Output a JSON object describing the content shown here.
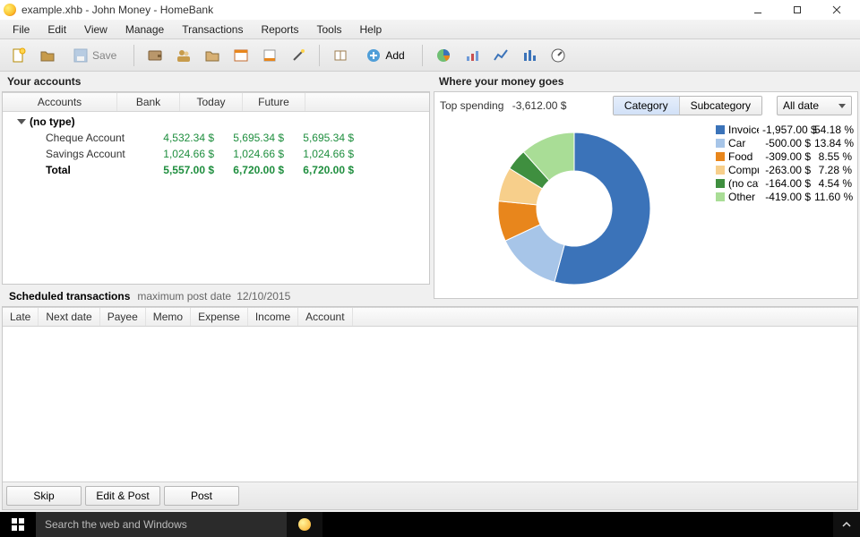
{
  "title": "example.xhb - John Money - HomeBank",
  "window_controls": {
    "minimize": "minimize",
    "maximize": "maximize",
    "close": "close"
  },
  "menu": [
    "File",
    "Edit",
    "View",
    "Manage",
    "Transactions",
    "Reports",
    "Tools",
    "Help"
  ],
  "toolbar": {
    "save_label": "Save",
    "add_label": "Add"
  },
  "accounts_panel": {
    "title": "Your accounts",
    "columns": [
      "Accounts",
      "Bank",
      "Today",
      "Future"
    ],
    "group_label": "(no type)",
    "rows": [
      {
        "name": "Cheque Account",
        "bank": "4,532.34 $",
        "today": "5,695.34 $",
        "future": "5,695.34 $"
      },
      {
        "name": "Savings Account",
        "bank": "1,024.66 $",
        "today": "1,024.66 $",
        "future": "1,024.66 $"
      }
    ],
    "total_label": "Total",
    "total": {
      "bank": "5,557.00 $",
      "today": "6,720.00 $",
      "future": "6,720.00 $"
    }
  },
  "spending_panel": {
    "title": "Where your money goes",
    "top_spending_label": "Top spending",
    "top_spending_amount": "-3,612.00 $",
    "segmented": {
      "category": "Category",
      "subcategory": "Subcategory"
    },
    "date_filter": "All date",
    "legend": [
      {
        "label": "Invoices",
        "amount": "-1,957.00 $",
        "pct": "54.18 %",
        "color": "#3b73b9"
      },
      {
        "label": "Car",
        "amount": "-500.00 $",
        "pct": "13.84 %",
        "color": "#a7c5e8"
      },
      {
        "label": "Food",
        "amount": "-309.00 $",
        "pct": "8.55 %",
        "color": "#e8861c"
      },
      {
        "label": "Computer",
        "amount": "-263.00 $",
        "pct": "7.28 %",
        "color": "#f7cf8b"
      },
      {
        "label": "(no category)",
        "amount": "-164.00 $",
        "pct": "4.54 %",
        "color": "#3f8f3f"
      },
      {
        "label": "Other",
        "amount": "-419.00 $",
        "pct": "11.60 %",
        "color": "#a9dd96"
      }
    ]
  },
  "chart_data": {
    "type": "pie",
    "title": "Where your money goes",
    "series": [
      {
        "name": "Invoices",
        "value": 1957.0,
        "pct": 54.18,
        "color": "#3b73b9"
      },
      {
        "name": "Car",
        "value": 500.0,
        "pct": 13.84,
        "color": "#a7c5e8"
      },
      {
        "name": "Food",
        "value": 309.0,
        "pct": 8.55,
        "color": "#e8861c"
      },
      {
        "name": "Computer",
        "value": 263.0,
        "pct": 7.28,
        "color": "#f7cf8b"
      },
      {
        "name": "(no category)",
        "value": 164.0,
        "pct": 4.54,
        "color": "#3f8f3f"
      },
      {
        "name": "Other",
        "value": 419.0,
        "pct": 11.6,
        "color": "#a9dd96"
      }
    ],
    "total": 3612.0,
    "currency_suffix": "$"
  },
  "scheduled": {
    "title": "Scheduled transactions",
    "subtitle_prefix": "maximum post date",
    "subtitle_date": "12/10/2015",
    "columns": [
      "Late",
      "Next date",
      "Payee",
      "Memo",
      "Expense",
      "Income",
      "Account"
    ],
    "buttons": {
      "skip": "Skip",
      "edit_post": "Edit & Post",
      "post": "Post"
    }
  },
  "taskbar": {
    "search_placeholder": "Search the web and Windows"
  }
}
